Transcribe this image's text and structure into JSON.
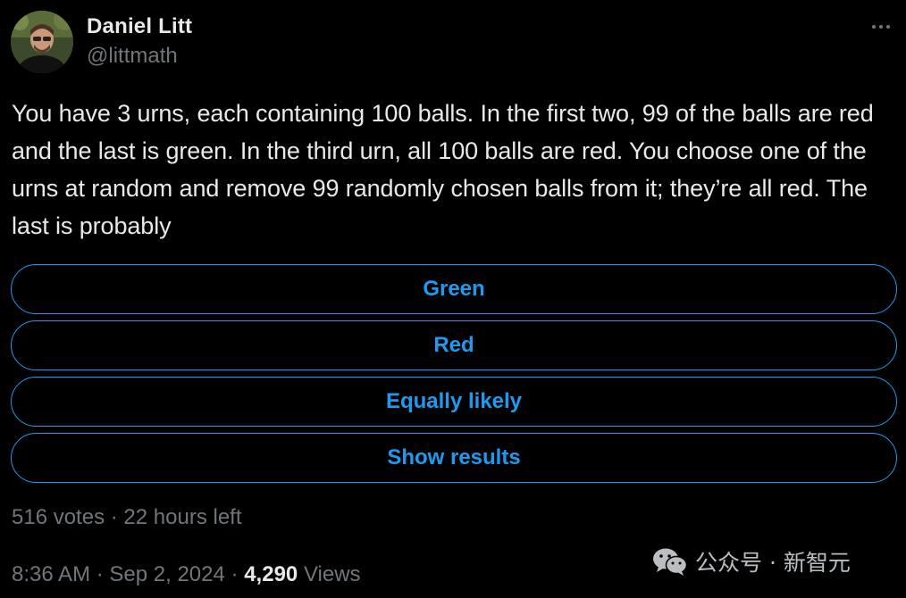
{
  "tweet": {
    "author": {
      "display_name": "Daniel Litt",
      "handle": "@littmath",
      "avatar_icon": "profile-photo"
    },
    "more_icon": "more-horizontal-icon",
    "text": "You have 3 urns, each containing 100 balls. In the first two, 99 of the balls are red and the last is green. In the third urn, all 100 balls are red. You choose one of the urns at random and remove 99 randomly chosen balls from it; they’re all red. The last is probably",
    "poll": {
      "options": [
        "Green",
        "Red",
        "Equally likely",
        "Show results"
      ],
      "votes": "516 votes",
      "separator": "·",
      "time_left": "22 hours left"
    },
    "meta": {
      "time": "8:36 AM",
      "separator": "·",
      "date": "Sep 2, 2024",
      "views_count": "4,290",
      "views_label": "Views"
    }
  },
  "watermark": {
    "icon": "wechat-icon",
    "text": "公众号 · 新智元"
  },
  "colors": {
    "background": "#000000",
    "text": "#e7e9ea",
    "secondary": "#71767b",
    "accent": "#1d9bf0"
  }
}
